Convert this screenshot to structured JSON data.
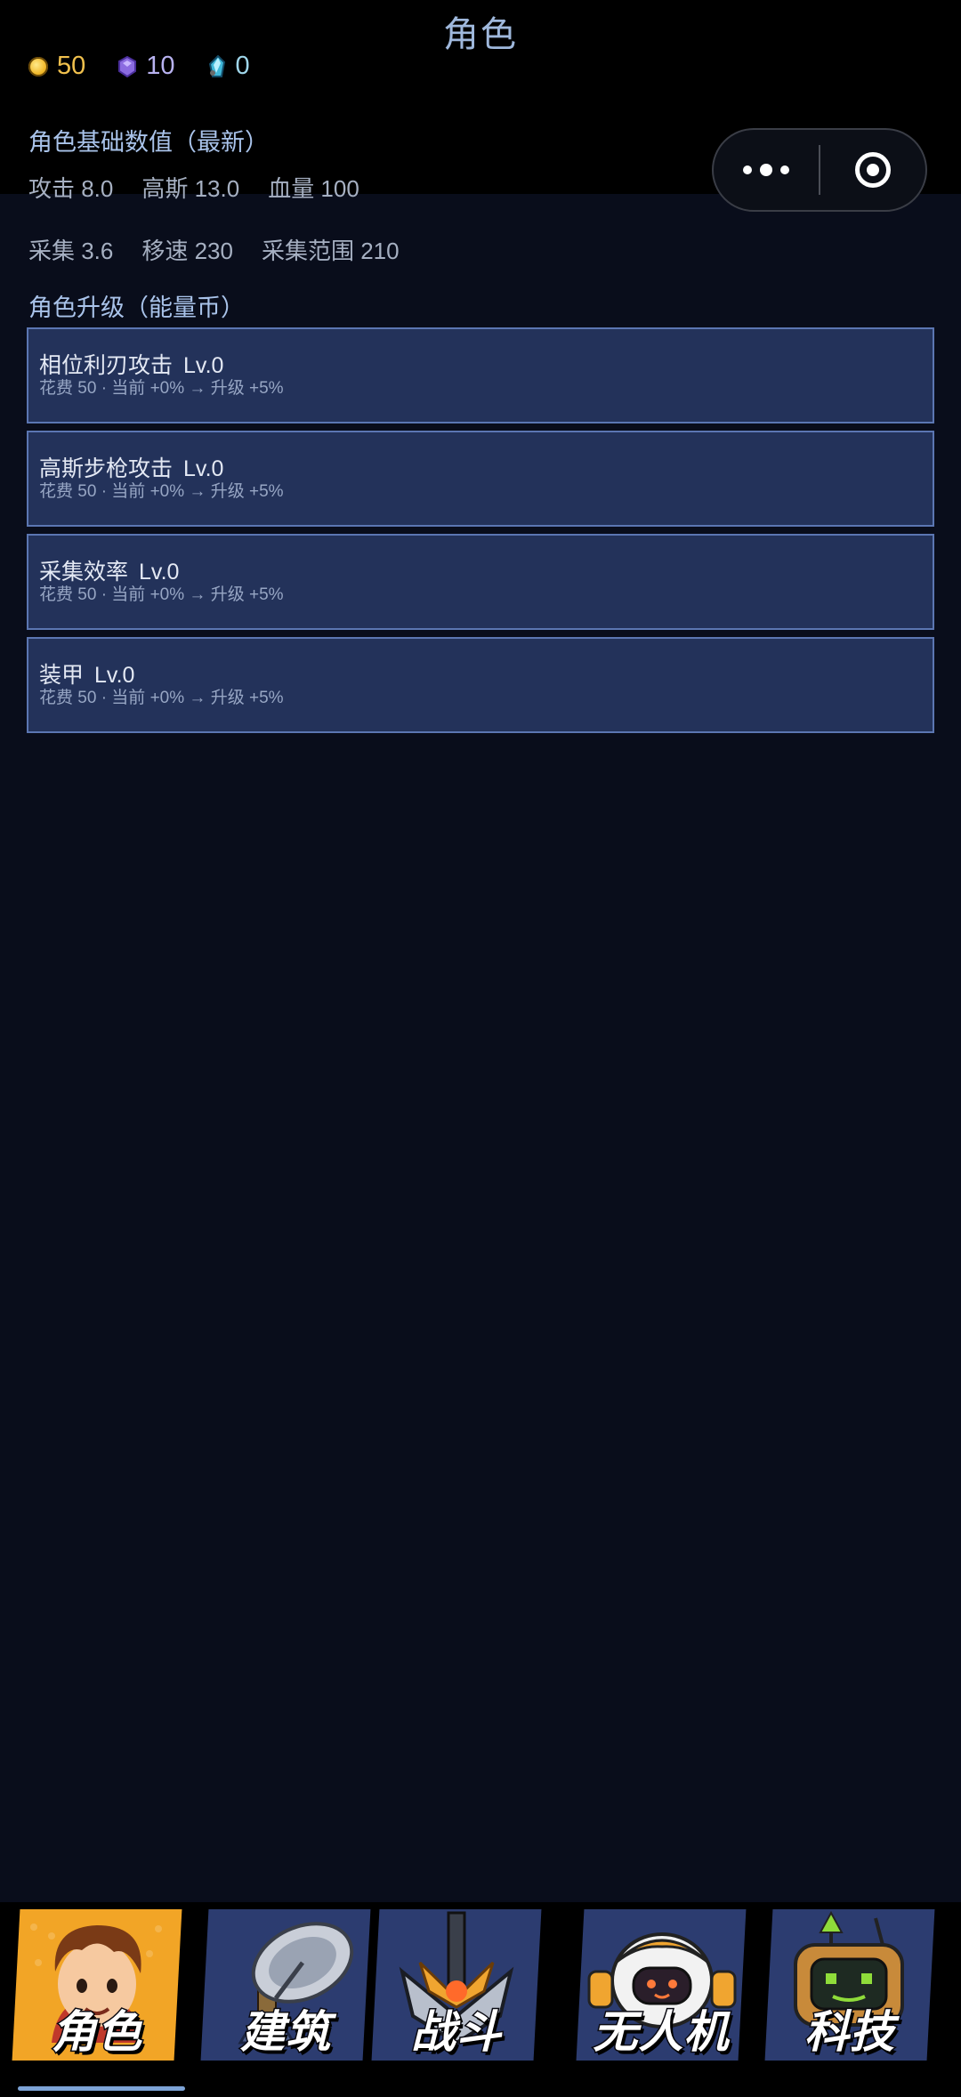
{
  "header": {
    "title": "角色",
    "currencies": [
      {
        "icon": "coin-icon",
        "value": "50"
      },
      {
        "icon": "gem-icon",
        "value": "10"
      },
      {
        "icon": "crystal-icon",
        "value": "0"
      }
    ]
  },
  "stats": {
    "title": "角色基础数值（最新）",
    "row1": [
      "攻击 8.0",
      "高斯 13.0",
      "血量 100"
    ],
    "row2": [
      "采集 3.6",
      "移速 230",
      "采集范围 210"
    ]
  },
  "upgrades": {
    "title": "角色升级（能量币）",
    "items": [
      {
        "name": "相位利刃攻击",
        "level": "Lv.0",
        "info": "花费 50 · 当前 +0% → 升级 +5%"
      },
      {
        "name": "高斯步枪攻击",
        "level": "Lv.0",
        "info": "花费 50 · 当前 +0% → 升级 +5%"
      },
      {
        "name": "采集效率",
        "level": "Lv.0",
        "info": "花费 50 · 当前 +0% → 升级 +5%"
      },
      {
        "name": "装甲",
        "level": "Lv.0",
        "info": "花费 50 · 当前 +0% → 升级 +5%"
      }
    ]
  },
  "tabs": [
    {
      "label": "角色",
      "icon": "character-portrait-icon",
      "active": true
    },
    {
      "label": "建筑",
      "icon": "satellite-dish-icon",
      "active": false
    },
    {
      "label": "战斗",
      "icon": "crossed-swords-emblem-icon",
      "active": false
    },
    {
      "label": "无人机",
      "icon": "robot-drone-icon",
      "active": false
    },
    {
      "label": "科技",
      "icon": "tech-robot-icon",
      "active": false
    }
  ],
  "colors": {
    "background": "#090d1b",
    "header": "#000000",
    "card_fill": "#23325a",
    "card_border": "#5b76b2",
    "section_title": "#a9c3ea",
    "coin": "#f0c04d",
    "tab_indicator": "#7da3d6"
  }
}
